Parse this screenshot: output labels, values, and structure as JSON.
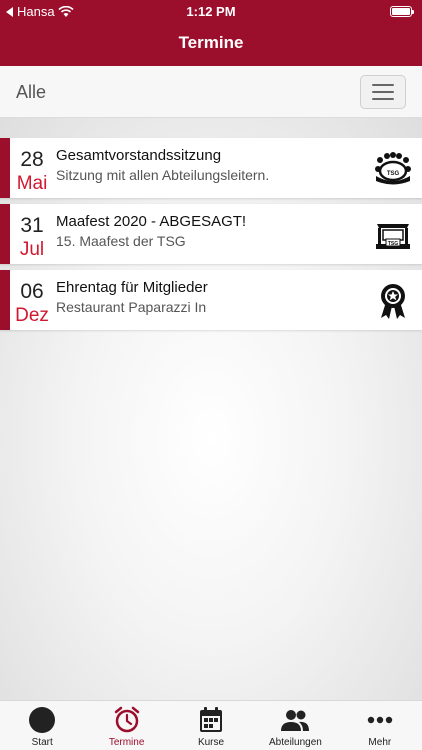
{
  "status_bar": {
    "carrier": "Hansa",
    "time": "1:12 PM"
  },
  "nav": {
    "title": "Termine"
  },
  "filter": {
    "label": "Alle"
  },
  "events": [
    {
      "day": "28",
      "month": "Mai",
      "title": "Gesamtvorstandssitzung",
      "subtitle": "Sitzung mit allen Abteilungsleitern.",
      "icon": "meeting-tsg-icon"
    },
    {
      "day": "31",
      "month": "Jul",
      "title": "Maafest 2020 - ABGESAGT!",
      "subtitle": "15. Maafest der TSG",
      "icon": "stage-tsg-icon"
    },
    {
      "day": "06",
      "month": "Dez",
      "title": "Ehrentag für Mitglieder",
      "subtitle": "Restaurant Paparazzi In",
      "icon": "award-rosette-icon"
    }
  ],
  "tabbar": {
    "items": [
      {
        "label": "Start",
        "icon": "start-circle-icon"
      },
      {
        "label": "Termine",
        "icon": "alarm-clock-icon",
        "active": true
      },
      {
        "label": "Kurse",
        "icon": "calendar-icon"
      },
      {
        "label": "Abteilungen",
        "icon": "people-icon"
      },
      {
        "label": "Mehr",
        "icon": "more-dots-icon"
      }
    ]
  },
  "colors": {
    "brand": "#9b0e2c",
    "month_red": "#d0182f"
  }
}
